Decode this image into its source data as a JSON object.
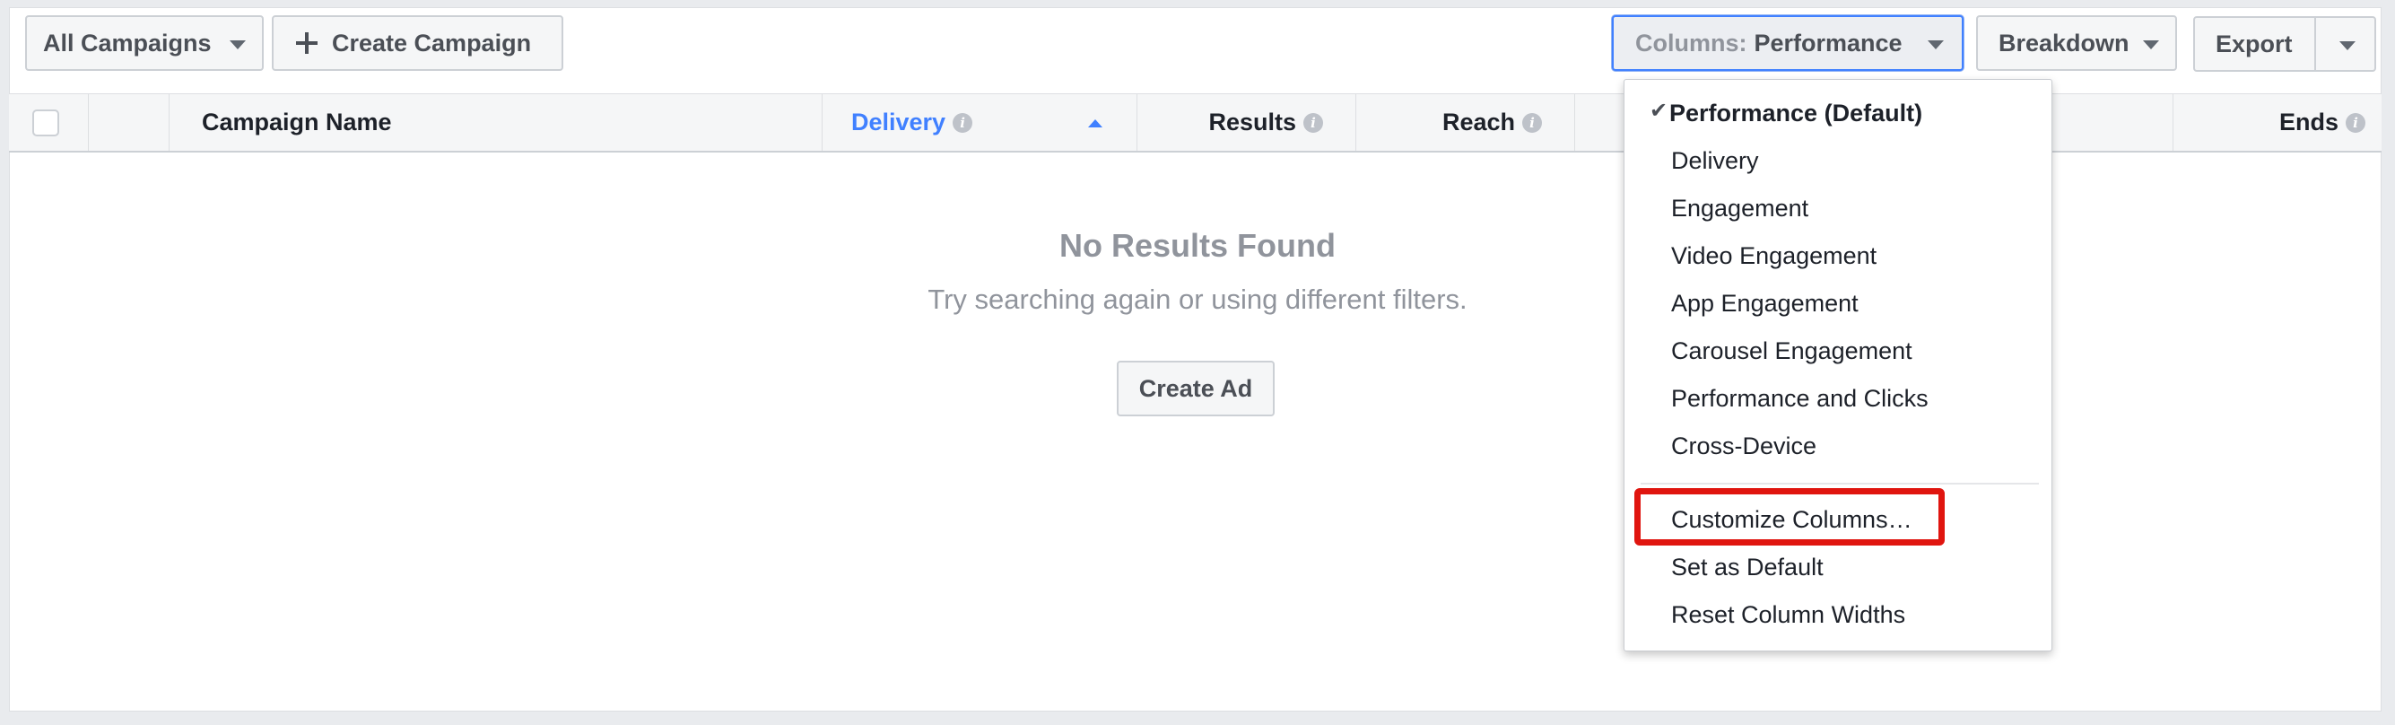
{
  "toolbar": {
    "all_campaigns_label": "All Campaigns",
    "create_campaign_label": "Create Campaign",
    "columns_prefix": "Columns:",
    "columns_value": "Performance",
    "breakdown_label": "Breakdown",
    "export_label": "Export"
  },
  "table": {
    "columns": {
      "campaign_name": "Campaign Name",
      "delivery": "Delivery",
      "results": "Results",
      "reach": "Reach",
      "ends": "Ends"
    },
    "info_glyph": "i"
  },
  "empty_state": {
    "title": "No Results Found",
    "subtitle": "Try searching again or using different filters.",
    "create_ad_label": "Create Ad"
  },
  "columns_menu": {
    "check_glyph": "✔",
    "items": [
      "Performance (Default)",
      "Delivery",
      "Engagement",
      "Video Engagement",
      "App Engagement",
      "Carousel Engagement",
      "Performance and Clicks",
      "Cross-Device"
    ],
    "actions": [
      "Customize Columns…",
      "Set as Default",
      "Reset Column Widths"
    ],
    "highlighted_action": "Customize Columns…"
  },
  "colors": {
    "accent": "#4080ff",
    "highlight": "#e0150f",
    "muted_text": "#90949c"
  }
}
